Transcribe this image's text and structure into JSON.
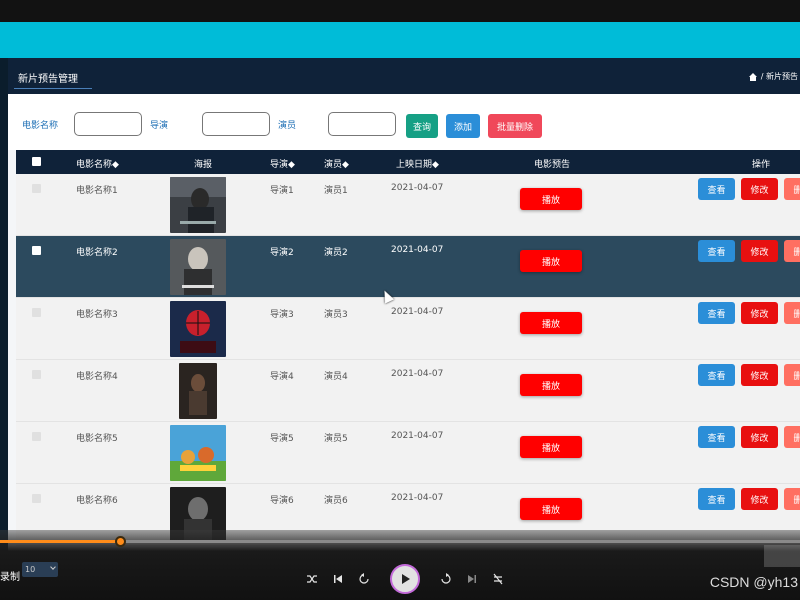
{
  "panel": {
    "title": "新片预告管理",
    "breadcrumb": "/ 新片预告"
  },
  "search": {
    "label_name": "电影名称",
    "value_name": "",
    "label_director": "导演",
    "value_director": "",
    "label_actor": "演员",
    "value_actor": "",
    "btn_query": "查询",
    "btn_add": "添加",
    "btn_batch_delete": "批量删除"
  },
  "table": {
    "headers": {
      "name": "电影名称◆",
      "poster": "海报",
      "director": "导演◆",
      "actor": "演员◆",
      "date": "上映日期◆",
      "trailer": "电影预告",
      "ops": "操作"
    },
    "play_label": "播放",
    "view_label": "查看",
    "edit_label": "修改",
    "delete_label": "删除",
    "rows": [
      {
        "name": "电影名称1",
        "director": "导演1",
        "actor": "演员1",
        "date": "2021-04-07"
      },
      {
        "name": "电影名称2",
        "director": "导演2",
        "actor": "演员2",
        "date": "2021-04-07"
      },
      {
        "name": "电影名称3",
        "director": "导演3",
        "actor": "演员3",
        "date": "2021-04-07"
      },
      {
        "name": "电影名称4",
        "director": "导演4",
        "actor": "演员4",
        "date": "2021-04-07"
      },
      {
        "name": "电影名称5",
        "director": "导演5",
        "actor": "演员5",
        "date": "2021-04-07"
      },
      {
        "name": "电影名称6",
        "director": "导演6",
        "actor": "演员6",
        "date": "2021-04-07"
      }
    ]
  },
  "player": {
    "label": "录制",
    "rate": "10",
    "progress": 0.15,
    "watermark": "CSDN @yh13"
  },
  "colors": {
    "accent": "#00bcd8",
    "header": "#0f2239",
    "play": "#ff0000",
    "view": "#2b8ed8",
    "edit": "#e81010",
    "delete": "#ff6f61",
    "progress": "#ff8c1a"
  }
}
